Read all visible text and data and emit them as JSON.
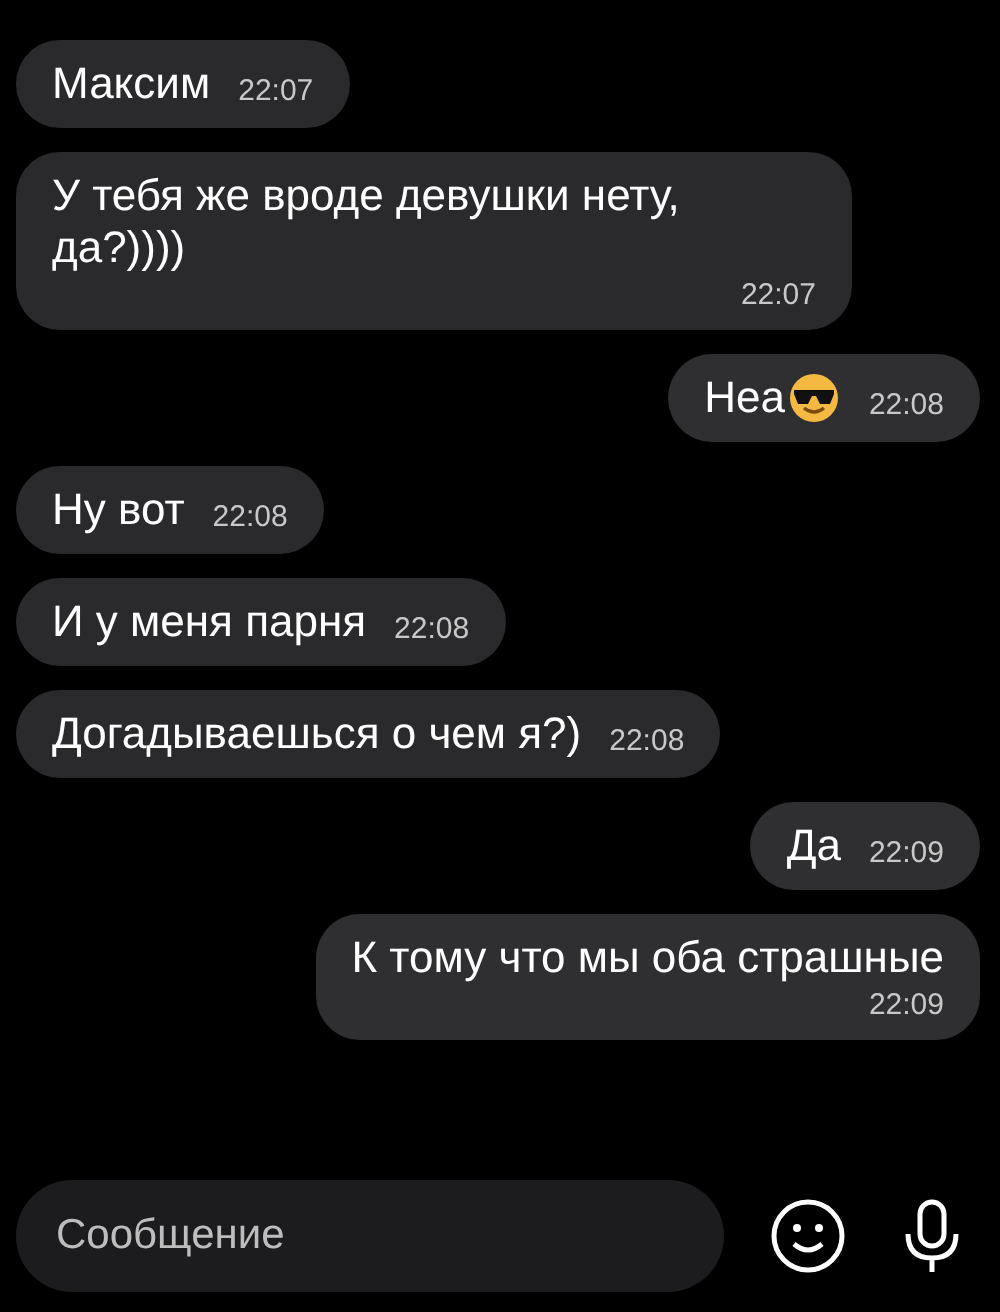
{
  "messages": [
    {
      "outgoing": false,
      "text": "Максим",
      "time": "22:07",
      "time_below": false,
      "emoji": false
    },
    {
      "outgoing": false,
      "text": "У тебя же вроде девушки нету, да?))))",
      "time": "22:07",
      "time_below": true,
      "emoji": false
    },
    {
      "outgoing": true,
      "text": "Неа",
      "time": "22:08",
      "time_below": false,
      "emoji": true
    },
    {
      "outgoing": false,
      "text": "Ну вот",
      "time": "22:08",
      "time_below": false,
      "emoji": false
    },
    {
      "outgoing": false,
      "text": "И у меня парня",
      "time": "22:08",
      "time_below": false,
      "emoji": false
    },
    {
      "outgoing": false,
      "text": "Догадываешься о чем я?)",
      "time": "22:08",
      "time_below": false,
      "emoji": false
    },
    {
      "outgoing": true,
      "text": "Да",
      "time": "22:09",
      "time_below": false,
      "emoji": false
    },
    {
      "outgoing": true,
      "text": "К тому что мы оба страшные",
      "time": "22:09",
      "time_below": true,
      "emoji": false
    }
  ],
  "composer": {
    "placeholder": "Сообщение"
  }
}
